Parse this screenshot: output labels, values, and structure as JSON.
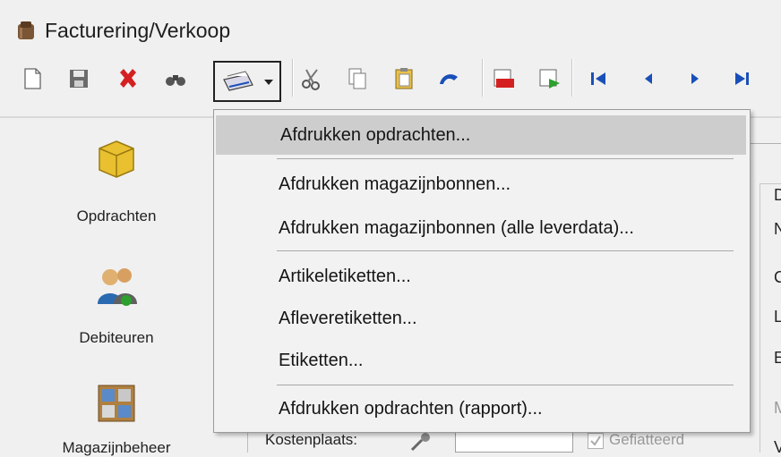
{
  "window": {
    "title": "Facturering/Verkoop"
  },
  "toolbar": {
    "buttons": [
      "new-icon",
      "save-icon",
      "delete-icon",
      "binoculars-icon",
      "print-icon",
      "cut-icon",
      "copy-icon",
      "paste-icon",
      "undo-icon",
      "export-red-icon",
      "export-green-icon",
      "first-icon",
      "prev-icon",
      "next-icon",
      "last-icon"
    ]
  },
  "sidebar": {
    "items": [
      {
        "label": "Opdrachten",
        "icon": "box-icon"
      },
      {
        "label": "Debiteuren",
        "icon": "people-icon"
      },
      {
        "label": "Magazijnbeheer",
        "icon": "warehouse-icon"
      }
    ]
  },
  "menu": {
    "items": [
      "Afdrukken opdrachten...",
      "Afdrukken magazijnbonnen...",
      "Afdrukken magazijnbonnen (alle leverdata)...",
      "Artikeletiketten...",
      "Afleveretiketten...",
      "Etiketten...",
      "Afdrukken opdrachten (rapport)..."
    ]
  },
  "form": {
    "kostenplaats_label": "Kostenplaats:",
    "gefiatteerd_label": "Gefiatteerd",
    "right_letters": [
      "N",
      "C",
      "L",
      "E",
      "M",
      "V"
    ]
  },
  "colors": {
    "menu_highlight": "#cdcdcd",
    "accent_red": "#d42020",
    "accent_blue": "#1a4fb8"
  }
}
